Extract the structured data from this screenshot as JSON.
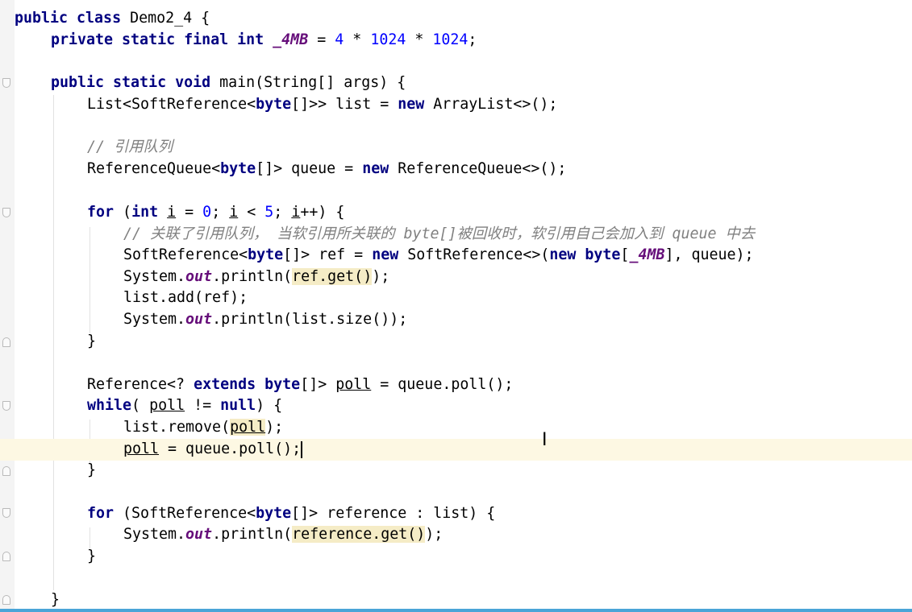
{
  "editor": {
    "class_decl": {
      "kw": "public class",
      "name": "Demo2_4 {"
    },
    "field_decl": {
      "kw": "private static final int",
      "name": "_4MB",
      "eq": "=",
      "v1": "4",
      "op1": "*",
      "v2": "1024",
      "op2": "*",
      "v3": "1024",
      "end": ";"
    },
    "main_decl": {
      "kw": "public static void",
      "rest": "main(String[] args) {"
    },
    "list_decl": {
      "t1": "List<SoftReference<",
      "kw1": "byte",
      "t2": "[]>> list = ",
      "kw2": "new",
      "t3": "ArrayList<>();"
    },
    "comment1": "// 引用队列",
    "queue_decl": {
      "t1": "ReferenceQueue<",
      "kw1": "byte",
      "t2": "[]> queue = ",
      "kw2": "new",
      "t3": "ReferenceQueue<>();"
    },
    "for1": {
      "kw1": "for",
      "t1": "(",
      "kw2": "int",
      "v1": "i",
      "t2": "=",
      "n1": "0",
      "t3": ";",
      "v2": "i",
      "t4": "<",
      "n2": "5",
      "t5": ";",
      "v3": "i",
      "t6": "++) {"
    },
    "comment2": "// 关联了引用队列， 当软引用所关联的 byte[]被回收时，软引用自己会加入到 queue 中去",
    "ref_decl": {
      "t1": "SoftReference<",
      "kw1": "byte",
      "t2": "[]> ref = ",
      "kw2": "new",
      "t3": "SoftReference<>(",
      "kw3": "new",
      "kw4": "byte",
      "t4": "[",
      "f1": "_4MB",
      "t5": "], queue);"
    },
    "print_get": {
      "t1": "System.",
      "f1": "out",
      "t2": ".println(",
      "hl": "ref.get()",
      "t3": ");"
    },
    "list_add": "list.add(ref);",
    "print_size": {
      "t1": "System.",
      "f1": "out",
      "t2": ".println(list.size());"
    },
    "close_for1": "}",
    "poll_decl": {
      "t1": "Reference<?",
      "kw1": "extends",
      "kw2": "byte",
      "t2": "[]>",
      "v1": "poll",
      "t3": "= queue.poll();"
    },
    "while_line": {
      "kw1": "while",
      "t1": "(",
      "v1": "poll",
      "t2": "!=",
      "kw2": "null",
      "t3": ") {"
    },
    "remove_line": {
      "t1": "list.remove(",
      "v1": "poll",
      "t2": ");"
    },
    "poll_assign": {
      "v1": "poll",
      "t1": "= queue.poll();"
    },
    "close_while": "}",
    "for2": {
      "kw1": "for",
      "t1": "(SoftReference<",
      "kw2": "byte",
      "t2": "[]> reference : list) {"
    },
    "print_ref": {
      "t1": "System.",
      "f1": "out",
      "t2": ".println(",
      "hl": "reference.get()",
      "t3": ");"
    },
    "close_for2": "}",
    "close_main": "}"
  }
}
